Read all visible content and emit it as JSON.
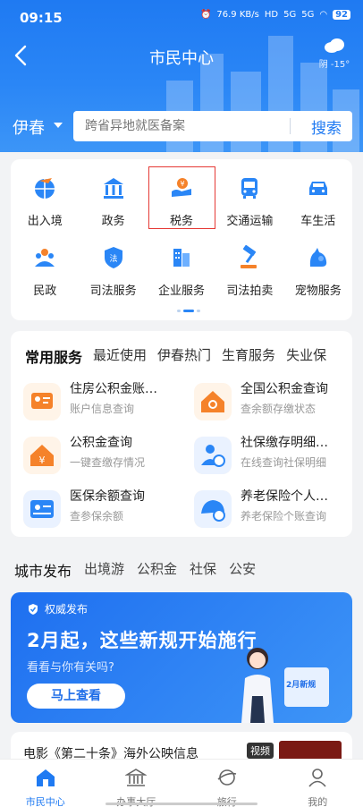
{
  "status_bar": {
    "time": "09:15",
    "network_speed": "76.9 KB/s",
    "hd": "HD",
    "signal1": "5G",
    "signal2": "5G",
    "battery": "92"
  },
  "header": {
    "title": "市民中心",
    "weather": "阴 -15°"
  },
  "search": {
    "city": "伊春",
    "placeholder": "跨省异地就医备案",
    "button": "搜索"
  },
  "service_grid": {
    "items": [
      {
        "label": "出入境",
        "icon": "globe-plane-icon"
      },
      {
        "label": "政务",
        "icon": "government-building-icon"
      },
      {
        "label": "税务",
        "icon": "tax-icon"
      },
      {
        "label": "交通运输",
        "icon": "bus-icon"
      },
      {
        "label": "车生活",
        "icon": "car-icon"
      },
      {
        "label": "民政",
        "icon": "people-icon"
      },
      {
        "label": "司法服务",
        "icon": "law-shield-icon"
      },
      {
        "label": "企业服务",
        "icon": "enterprise-icon"
      },
      {
        "label": "司法拍卖",
        "icon": "gavel-icon"
      },
      {
        "label": "宠物服务",
        "icon": "pet-icon"
      }
    ],
    "selected_index": 2
  },
  "common_services": {
    "tabs": [
      "常用服务",
      "最近使用",
      "伊春热门",
      "生育服务",
      "失业保"
    ],
    "items": [
      {
        "title": "住房公积金账…",
        "subtitle": "账户信息查询",
        "icon": "housing-fund-icon"
      },
      {
        "title": "全国公积金查询",
        "subtitle": "查余额存缴状态",
        "icon": "house-search-icon"
      },
      {
        "title": "公积金查询",
        "subtitle": "一键查缴存情况",
        "icon": "house-yuan-icon"
      },
      {
        "title": "社保缴存明细…",
        "subtitle": "在线查询社保明细",
        "icon": "social-security-icon"
      },
      {
        "title": "医保余额查询",
        "subtitle": "查参保余额",
        "icon": "medical-card-icon"
      },
      {
        "title": "养老保险个人…",
        "subtitle": "养老保险个账查询",
        "icon": "pension-icon"
      }
    ]
  },
  "news": {
    "tabs": [
      "城市发布",
      "出境游",
      "公积金",
      "社保",
      "公安"
    ],
    "banner": {
      "tag": "权威发布",
      "title": "2月起，这些新规开始施行",
      "subtitle": "看看与你有关吗?",
      "button": "马上查看",
      "board_text": "2月新规"
    },
    "item": {
      "text": "电影《第二十条》海外公映信息",
      "tag": "视频"
    }
  },
  "bottom_nav": [
    {
      "label": "市民中心",
      "icon": "home-icon",
      "active": true
    },
    {
      "label": "办事大厅",
      "icon": "hall-icon",
      "active": false
    },
    {
      "label": "旅行",
      "icon": "travel-icon",
      "active": false
    },
    {
      "label": "我的",
      "icon": "user-icon",
      "active": false
    }
  ],
  "colors": {
    "primary": "#1f7af2",
    "accent_orange": "#f5822a",
    "selected_border": "#e53935"
  }
}
